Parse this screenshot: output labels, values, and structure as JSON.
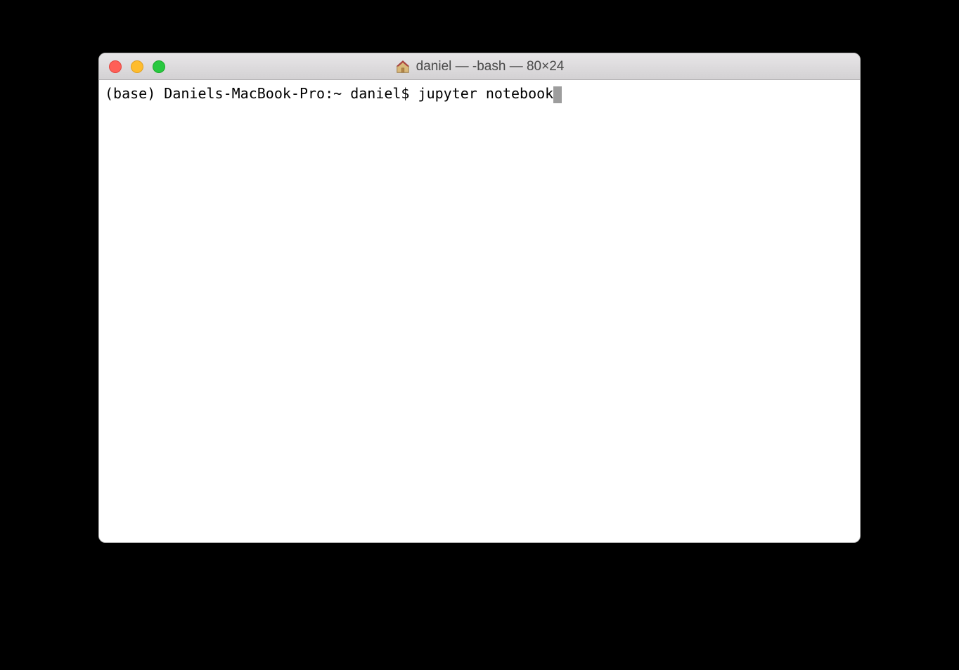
{
  "window": {
    "title": "daniel — -bash — 80×24"
  },
  "terminal": {
    "prompt": "(base) Daniels-MacBook-Pro:~ daniel$ ",
    "command": "jupyter notebook"
  }
}
